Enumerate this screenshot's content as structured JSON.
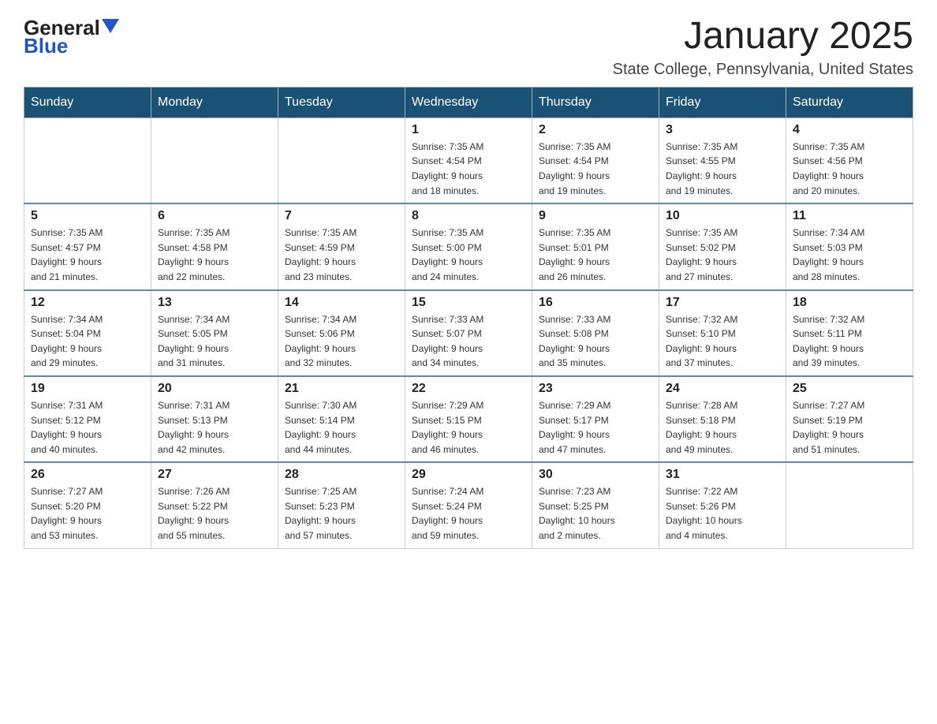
{
  "header": {
    "logo_general": "General",
    "logo_blue": "Blue",
    "month_title": "January 2025",
    "location": "State College, Pennsylvania, United States"
  },
  "weekdays": [
    "Sunday",
    "Monday",
    "Tuesday",
    "Wednesday",
    "Thursday",
    "Friday",
    "Saturday"
  ],
  "weeks": [
    [
      {
        "day": "",
        "info": ""
      },
      {
        "day": "",
        "info": ""
      },
      {
        "day": "",
        "info": ""
      },
      {
        "day": "1",
        "info": "Sunrise: 7:35 AM\nSunset: 4:54 PM\nDaylight: 9 hours\nand 18 minutes."
      },
      {
        "day": "2",
        "info": "Sunrise: 7:35 AM\nSunset: 4:54 PM\nDaylight: 9 hours\nand 19 minutes."
      },
      {
        "day": "3",
        "info": "Sunrise: 7:35 AM\nSunset: 4:55 PM\nDaylight: 9 hours\nand 19 minutes."
      },
      {
        "day": "4",
        "info": "Sunrise: 7:35 AM\nSunset: 4:56 PM\nDaylight: 9 hours\nand 20 minutes."
      }
    ],
    [
      {
        "day": "5",
        "info": "Sunrise: 7:35 AM\nSunset: 4:57 PM\nDaylight: 9 hours\nand 21 minutes."
      },
      {
        "day": "6",
        "info": "Sunrise: 7:35 AM\nSunset: 4:58 PM\nDaylight: 9 hours\nand 22 minutes."
      },
      {
        "day": "7",
        "info": "Sunrise: 7:35 AM\nSunset: 4:59 PM\nDaylight: 9 hours\nand 23 minutes."
      },
      {
        "day": "8",
        "info": "Sunrise: 7:35 AM\nSunset: 5:00 PM\nDaylight: 9 hours\nand 24 minutes."
      },
      {
        "day": "9",
        "info": "Sunrise: 7:35 AM\nSunset: 5:01 PM\nDaylight: 9 hours\nand 26 minutes."
      },
      {
        "day": "10",
        "info": "Sunrise: 7:35 AM\nSunset: 5:02 PM\nDaylight: 9 hours\nand 27 minutes."
      },
      {
        "day": "11",
        "info": "Sunrise: 7:34 AM\nSunset: 5:03 PM\nDaylight: 9 hours\nand 28 minutes."
      }
    ],
    [
      {
        "day": "12",
        "info": "Sunrise: 7:34 AM\nSunset: 5:04 PM\nDaylight: 9 hours\nand 29 minutes."
      },
      {
        "day": "13",
        "info": "Sunrise: 7:34 AM\nSunset: 5:05 PM\nDaylight: 9 hours\nand 31 minutes."
      },
      {
        "day": "14",
        "info": "Sunrise: 7:34 AM\nSunset: 5:06 PM\nDaylight: 9 hours\nand 32 minutes."
      },
      {
        "day": "15",
        "info": "Sunrise: 7:33 AM\nSunset: 5:07 PM\nDaylight: 9 hours\nand 34 minutes."
      },
      {
        "day": "16",
        "info": "Sunrise: 7:33 AM\nSunset: 5:08 PM\nDaylight: 9 hours\nand 35 minutes."
      },
      {
        "day": "17",
        "info": "Sunrise: 7:32 AM\nSunset: 5:10 PM\nDaylight: 9 hours\nand 37 minutes."
      },
      {
        "day": "18",
        "info": "Sunrise: 7:32 AM\nSunset: 5:11 PM\nDaylight: 9 hours\nand 39 minutes."
      }
    ],
    [
      {
        "day": "19",
        "info": "Sunrise: 7:31 AM\nSunset: 5:12 PM\nDaylight: 9 hours\nand 40 minutes."
      },
      {
        "day": "20",
        "info": "Sunrise: 7:31 AM\nSunset: 5:13 PM\nDaylight: 9 hours\nand 42 minutes."
      },
      {
        "day": "21",
        "info": "Sunrise: 7:30 AM\nSunset: 5:14 PM\nDaylight: 9 hours\nand 44 minutes."
      },
      {
        "day": "22",
        "info": "Sunrise: 7:29 AM\nSunset: 5:15 PM\nDaylight: 9 hours\nand 46 minutes."
      },
      {
        "day": "23",
        "info": "Sunrise: 7:29 AM\nSunset: 5:17 PM\nDaylight: 9 hours\nand 47 minutes."
      },
      {
        "day": "24",
        "info": "Sunrise: 7:28 AM\nSunset: 5:18 PM\nDaylight: 9 hours\nand 49 minutes."
      },
      {
        "day": "25",
        "info": "Sunrise: 7:27 AM\nSunset: 5:19 PM\nDaylight: 9 hours\nand 51 minutes."
      }
    ],
    [
      {
        "day": "26",
        "info": "Sunrise: 7:27 AM\nSunset: 5:20 PM\nDaylight: 9 hours\nand 53 minutes."
      },
      {
        "day": "27",
        "info": "Sunrise: 7:26 AM\nSunset: 5:22 PM\nDaylight: 9 hours\nand 55 minutes."
      },
      {
        "day": "28",
        "info": "Sunrise: 7:25 AM\nSunset: 5:23 PM\nDaylight: 9 hours\nand 57 minutes."
      },
      {
        "day": "29",
        "info": "Sunrise: 7:24 AM\nSunset: 5:24 PM\nDaylight: 9 hours\nand 59 minutes."
      },
      {
        "day": "30",
        "info": "Sunrise: 7:23 AM\nSunset: 5:25 PM\nDaylight: 10 hours\nand 2 minutes."
      },
      {
        "day": "31",
        "info": "Sunrise: 7:22 AM\nSunset: 5:26 PM\nDaylight: 10 hours\nand 4 minutes."
      },
      {
        "day": "",
        "info": ""
      }
    ]
  ]
}
